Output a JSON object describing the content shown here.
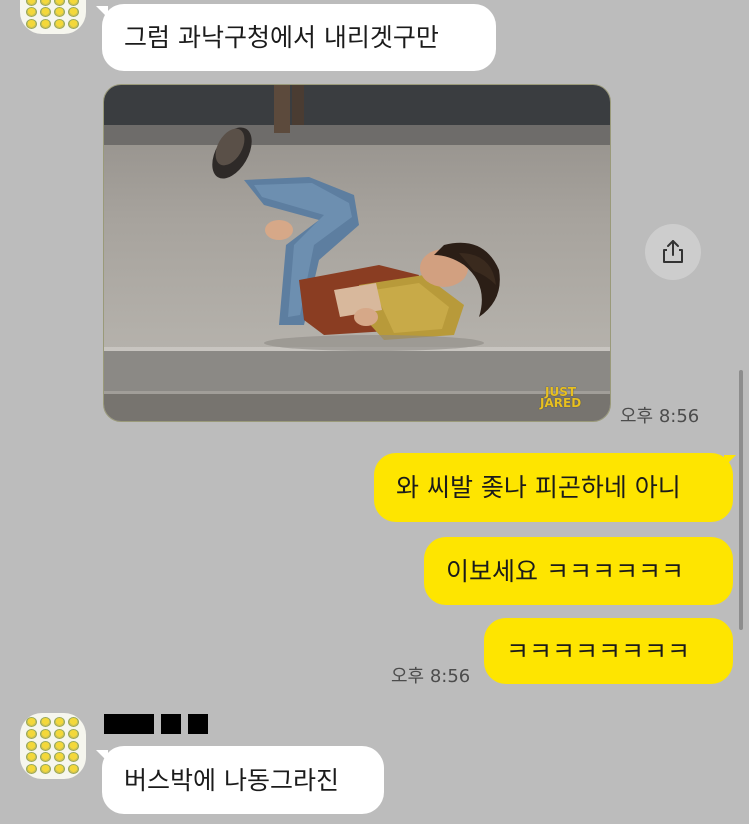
{
  "messages": {
    "m1_text": "그럼 과낙구청에서 내리겟구만",
    "photo_time": "오후 8:56",
    "photo_watermark_top": "JUST",
    "photo_watermark_bottom": "JARED",
    "m2_text": "와 씨발 좆나 피곤하네 아니",
    "m3_text": "이보세요 ㅋㅋㅋㅋㅋㅋ",
    "m4_text": "ㅋㅋㅋㅋㅋㅋㅋㅋ",
    "m4_time": "오후 8:56",
    "m5_text": "버스박에 나동그라진"
  },
  "icons": {
    "share": "share-icon"
  },
  "colors": {
    "background": "#bcbcbc",
    "incoming_bubble": "#ffffff",
    "outgoing_bubble": "#fee500"
  }
}
